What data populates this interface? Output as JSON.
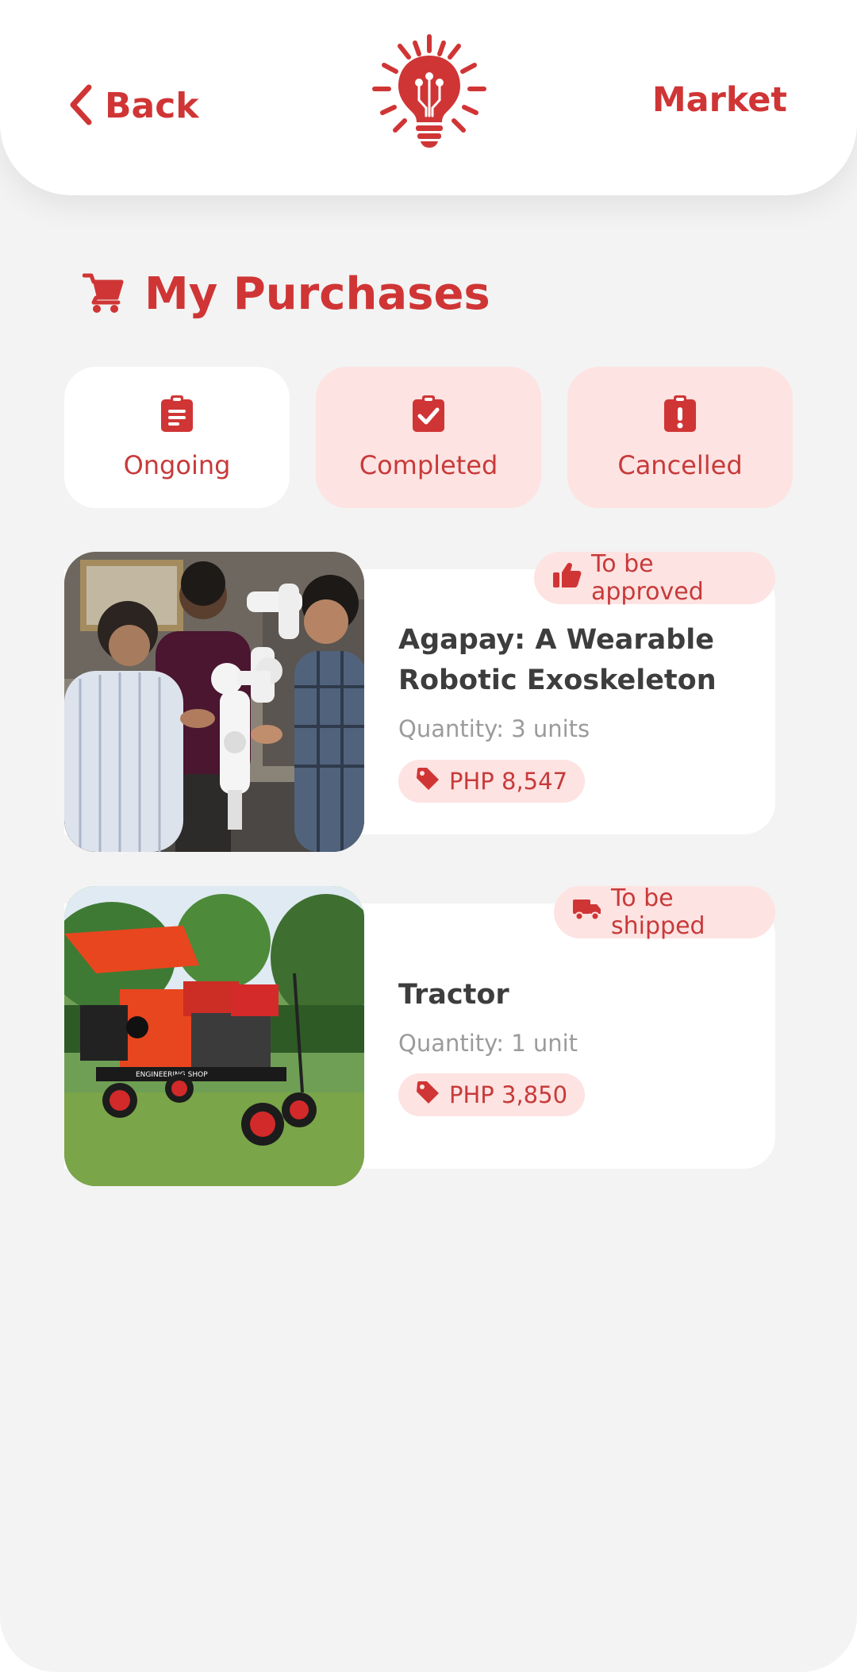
{
  "header": {
    "back_label": "Back",
    "market_label": "Market",
    "logo_icon": "circuit-lightbulb-sun-logo"
  },
  "page": {
    "title": "My Purchases",
    "title_icon": "shopping-cart-icon"
  },
  "tabs": [
    {
      "label": "Ongoing",
      "icon": "clipboard-list-icon",
      "active": true
    },
    {
      "label": "Completed",
      "icon": "clipboard-check-icon",
      "active": false
    },
    {
      "label": "Cancelled",
      "icon": "clipboard-exclamation-icon",
      "active": false
    }
  ],
  "purchases": [
    {
      "status": "To be approved",
      "status_icon": "thumbs-up-icon",
      "name_lines": [
        "Agapay: A Wearable",
        "Robotic Exoskeleton"
      ],
      "quantity": "Quantity: 3 units",
      "price": "PHP 8,547",
      "price_icon": "price-tag-icon",
      "image_description": "people-around-white-robotic-arm-photo"
    },
    {
      "status": "To be shipped",
      "status_icon": "truck-icon",
      "name_lines": [
        "Tractor"
      ],
      "quantity": "Quantity: 1 unit",
      "price": "PHP 3,850",
      "price_icon": "price-tag-icon",
      "image_description": "red-black-tractor-on-lawn-photo"
    }
  ],
  "colors": {
    "brand_red": "#d03535",
    "soft_pink": "#fde3e2",
    "background": "#f3f3f3",
    "card": "#ffffff",
    "text_dark": "#3d3d3d",
    "text_muted": "#9b9b9b"
  }
}
